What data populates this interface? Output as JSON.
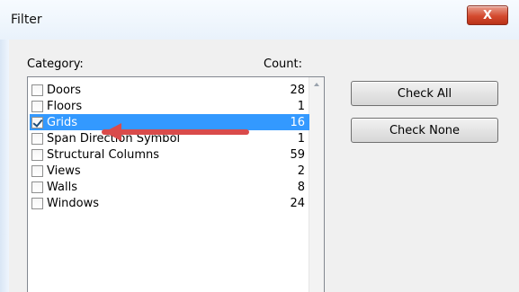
{
  "window": {
    "title": "Filter",
    "close_label": "X"
  },
  "labels": {
    "category": "Category:",
    "count": "Count:"
  },
  "list": [
    {
      "name": "Doors",
      "count": "28",
      "checked": false,
      "selected": false
    },
    {
      "name": "Floors",
      "count": "1",
      "checked": false,
      "selected": false
    },
    {
      "name": "Grids",
      "count": "16",
      "checked": true,
      "selected": true
    },
    {
      "name": "Span Direction Symbol",
      "count": "1",
      "checked": false,
      "selected": false
    },
    {
      "name": "Structural Columns",
      "count": "59",
      "checked": false,
      "selected": false
    },
    {
      "name": "Views",
      "count": "2",
      "checked": false,
      "selected": false
    },
    {
      "name": "Walls",
      "count": "8",
      "checked": false,
      "selected": false
    },
    {
      "name": "Windows",
      "count": "24",
      "checked": false,
      "selected": false
    }
  ],
  "buttons": {
    "check_all": "Check All",
    "check_none": "Check None"
  },
  "colors": {
    "selection": "#3399ff",
    "arrow": "#d94b4b"
  }
}
